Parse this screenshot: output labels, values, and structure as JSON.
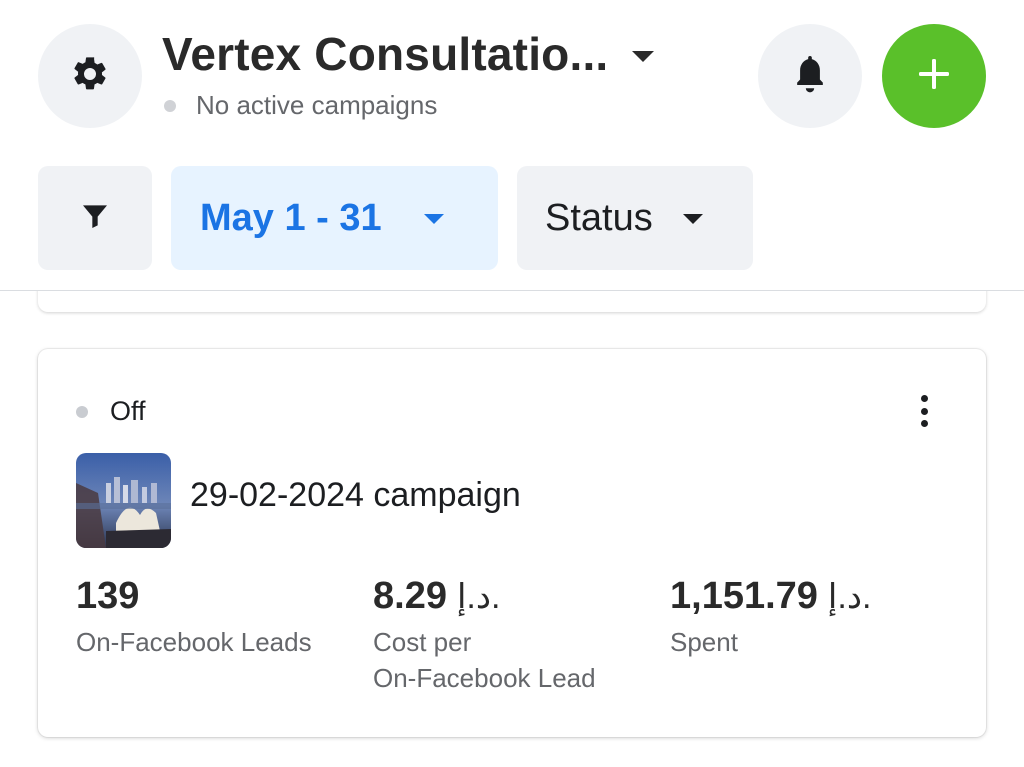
{
  "header": {
    "account_name": "Vertex Consultatio...",
    "status_text": "No active campaigns"
  },
  "filters": {
    "date_range": "May 1 - 31",
    "status_label": "Status"
  },
  "campaign": {
    "status": "Off",
    "name": "29-02-2024 campaign",
    "metrics": [
      {
        "value": "139",
        "currency": "",
        "label": "On-Facebook Leads"
      },
      {
        "value": "8.29",
        "currency": "د.إ.",
        "label_line1": "Cost per",
        "label_line2": "On-Facebook Lead"
      },
      {
        "value": "1,151.79",
        "currency": "د.إ.",
        "label": "Spent"
      }
    ]
  },
  "colors": {
    "accent_blue": "#1b74e4",
    "add_green": "#5ac02a",
    "chip_bg": "#f0f2f5",
    "chip_active_bg": "#e7f3ff"
  },
  "icons": {
    "settings": "gear-icon",
    "notifications": "bell-icon",
    "create": "plus-icon",
    "filter": "funnel-icon",
    "more": "more-vertical-icon"
  }
}
